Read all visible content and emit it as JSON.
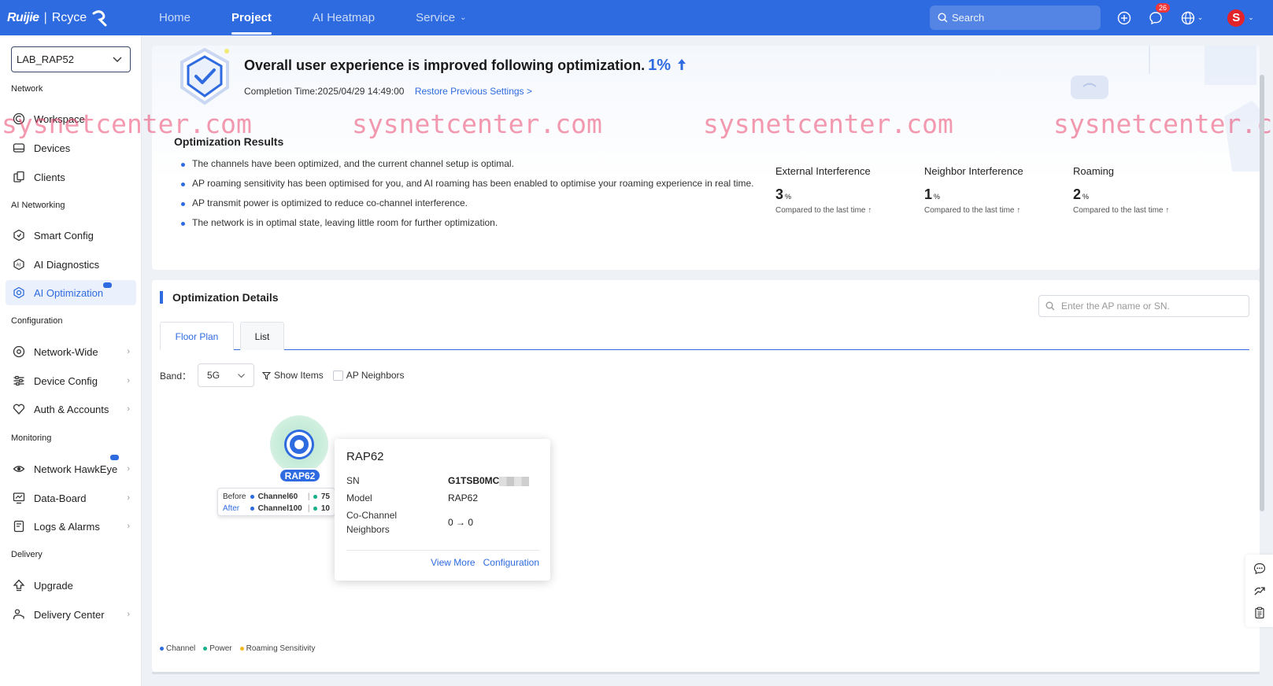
{
  "brand": {
    "left": "Ruijie",
    "separator": "|",
    "right": "Rcyce"
  },
  "nav": {
    "items": [
      {
        "label": "Home",
        "active": false
      },
      {
        "label": "Project",
        "active": true
      },
      {
        "label": "AI Heatmap",
        "active": false
      },
      {
        "label": "Service",
        "active": false
      }
    ]
  },
  "header": {
    "search_placeholder": "Search",
    "notification_count": "26",
    "avatar_letter": "S"
  },
  "sidebar": {
    "site": "LAB_RAP52",
    "sections": {
      "network": "Network",
      "ai_networking": "AI Networking",
      "configuration": "Configuration",
      "monitoring": "Monitoring",
      "delivery": "Delivery"
    },
    "items": {
      "workspace": "Workspace",
      "devices": "Devices",
      "clients": "Clients",
      "smart_config": "Smart Config",
      "ai_diagnostics": "AI Diagnostics",
      "ai_optimization": "AI Optimization",
      "network_wide": "Network-Wide",
      "device_config": "Device Config",
      "auth_accounts": "Auth & Accounts",
      "network_hawkeye": "Network HawkEye",
      "data_board": "Data-Board",
      "logs_alarms": "Logs & Alarms",
      "upgrade": "Upgrade",
      "delivery_center": "Delivery Center"
    }
  },
  "summary": {
    "headline": "Overall user experience is improved following optimization.",
    "improvement": "1%",
    "completion_label": "Completion Time:",
    "completion_time": "2025/04/29 14:49:00",
    "restore_link": "Restore Previous Settings >"
  },
  "watermark": "sysnetcenter.com",
  "results": {
    "title": "Optimization Results",
    "items": [
      "The channels have been optimized, and the current channel setup is optimal.",
      "AP roaming sensitivity has been optimised for you, and AI roaming has been enabled to optimise your roaming experience in real time.",
      "AP transmit power is optimized to reduce co-channel interference.",
      "The network is in optimal state, leaving little room for further optimization."
    ],
    "metrics": [
      {
        "title": "External Interference",
        "value": "3",
        "unit": "%",
        "compare": "Compared to the last time"
      },
      {
        "title": "Neighbor Interference",
        "value": "1",
        "unit": "%",
        "compare": "Compared to the last time"
      },
      {
        "title": "Roaming",
        "value": "2",
        "unit": "%",
        "compare": "Compared to the last time"
      }
    ]
  },
  "details": {
    "title": "Optimization Details",
    "search_placeholder": "Enter the AP name or SN.",
    "tabs": [
      {
        "label": "Floor Plan",
        "active": true
      },
      {
        "label": "List",
        "active": false
      }
    ],
    "band_label": "Band：",
    "band_value": "5G",
    "show_items": "Show Items",
    "ap_neighbors": "AP Neighbors",
    "ap": {
      "name": "RAP62",
      "before_label": "Before",
      "after_label": "After",
      "before_channel": "Channel60",
      "after_channel": "Channel100",
      "before_power": "75",
      "after_power": "10"
    },
    "popup": {
      "title": "RAP62",
      "sn_label": "SN",
      "sn_value": "G1TSB0MC",
      "model_label": "Model",
      "model_value": "RAP62",
      "neighbors_label": "Co-Channel Neighbors",
      "neighbors_before": "0",
      "neighbors_arrow": "→",
      "neighbors_after": "0",
      "view_more": "View More",
      "configuration": "Configuration"
    },
    "legend": {
      "channel": "Channel",
      "power": "Power",
      "roaming": "Roaming Sensitivity"
    }
  },
  "colors": {
    "primary": "#2f6be0",
    "topbar": "#2f6be0",
    "power": "#17b18a",
    "roaming": "#f2b821",
    "badge": "#f0383b"
  }
}
